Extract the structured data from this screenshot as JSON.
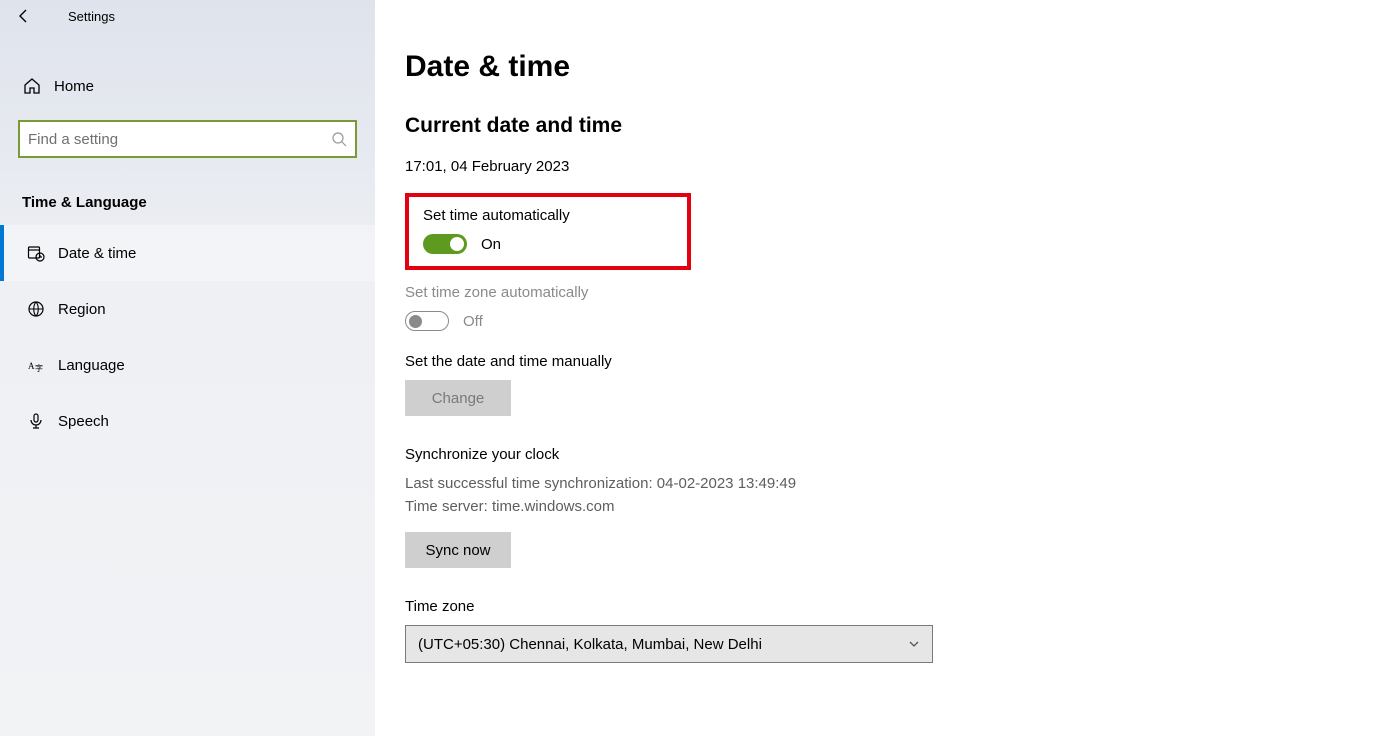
{
  "header": {
    "app_title": "Settings"
  },
  "sidebar": {
    "home_label": "Home",
    "search_placeholder": "Find a setting",
    "category_title": "Time & Language",
    "items": [
      {
        "label": "Date & time"
      },
      {
        "label": "Region"
      },
      {
        "label": "Language"
      },
      {
        "label": "Speech"
      }
    ]
  },
  "main": {
    "page_title": "Date & time",
    "current_heading": "Current date and time",
    "current_value": "17:01, 04 February 2023",
    "set_time_auto_label": "Set time automatically",
    "set_time_auto_state": "On",
    "set_tz_auto_label": "Set time zone automatically",
    "set_tz_auto_state": "Off",
    "manual_label": "Set the date and time manually",
    "change_button": "Change",
    "sync_heading": "Synchronize your clock",
    "sync_last_label": "Last successful time synchronization:",
    "sync_last_value": "04-02-2023 13:49:49",
    "sync_server_label": "Time server:",
    "sync_server_value": "time.windows.com",
    "sync_button": "Sync now",
    "tz_label": "Time zone",
    "tz_value": "(UTC+05:30) Chennai, Kolkata, Mumbai, New Delhi"
  }
}
